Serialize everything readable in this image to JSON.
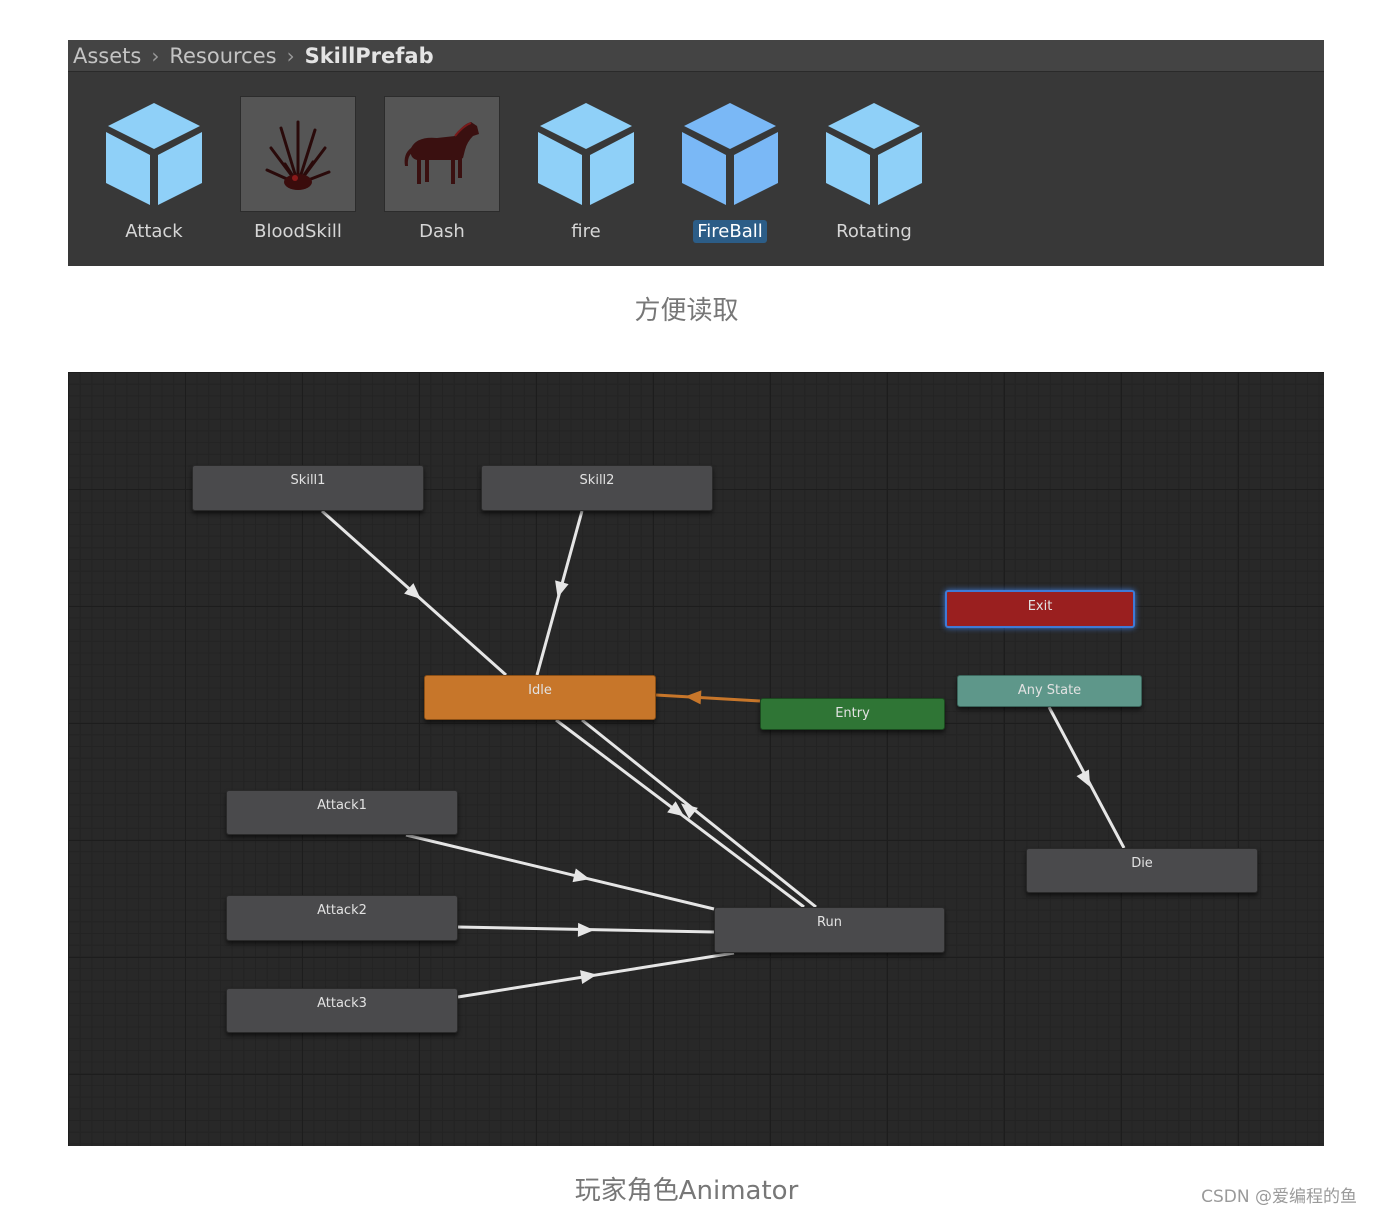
{
  "project": {
    "breadcrumb": [
      "Assets",
      "Resources",
      "SkillPrefab"
    ],
    "assets": [
      {
        "label": "Attack",
        "icon": "prefab-cube-icon",
        "selected": false
      },
      {
        "label": "BloodSkill",
        "icon": "blood-skill-thumbnail",
        "selected": false
      },
      {
        "label": "Dash",
        "icon": "horse-thumbnail",
        "selected": false
      },
      {
        "label": "fire",
        "icon": "prefab-cube-icon",
        "selected": false
      },
      {
        "label": "FireBall",
        "icon": "prefab-cube-icon",
        "selected": true
      },
      {
        "label": "Rotating",
        "icon": "prefab-cube-icon",
        "selected": false
      }
    ]
  },
  "caption_top": "方便读取",
  "animator": {
    "states": {
      "skill1": "Skill1",
      "skill2": "Skill2",
      "exit": "Exit",
      "idle": "Idle",
      "entry": "Entry",
      "any_state": "Any State",
      "attack1": "Attack1",
      "attack2": "Attack2",
      "attack3": "Attack3",
      "run": "Run",
      "die": "Die"
    },
    "colors": {
      "idle": "#c7762a",
      "entry": "#2f7535",
      "any_state": "#5e978a",
      "exit": "#9a1f1f",
      "default_state": "#4a4a4c",
      "transition": "#e6e6e6",
      "entry_transition": "#c7762a"
    }
  },
  "caption_bottom": "玩家角色Animator",
  "watermark": "CSDN @爱编程的鱼"
}
